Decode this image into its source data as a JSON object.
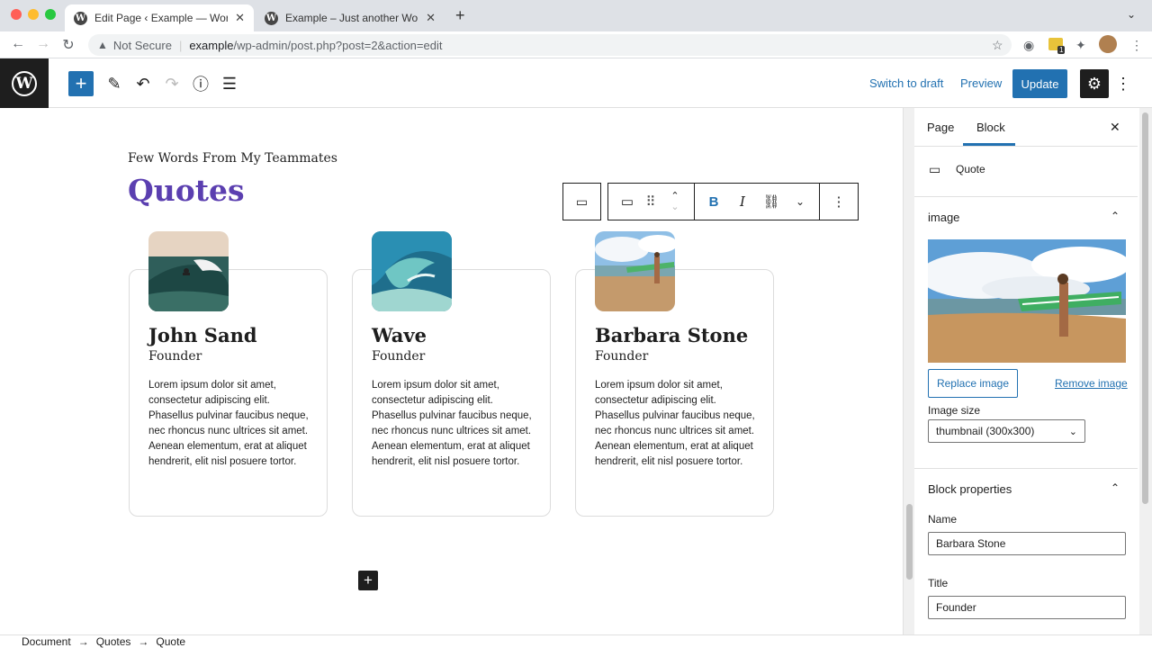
{
  "browser": {
    "tabs": [
      {
        "title": "Edit Page ‹ Example — WordPr",
        "active": true
      },
      {
        "title": "Example – Just another WordP",
        "active": false
      }
    ],
    "security_label": "Not Secure",
    "url_host": "example",
    "url_path": "/wp-admin/post.php?post=2&action=edit",
    "extension_badge": "1"
  },
  "topbar": {
    "switch_to_draft": "Switch to draft",
    "preview": "Preview",
    "update": "Update"
  },
  "content": {
    "subtitle": "Few Words From My Teammates",
    "heading": "Quotes",
    "heading_color": "#5b3fb0",
    "cards": [
      {
        "name": "John Sand",
        "title": "Founder",
        "body": "Lorem ipsum dolor sit amet, consectetur adipiscing elit. Phasellus pulvinar faucibus neque, nec rhoncus nunc ultrices sit amet. Aenean elementum, erat at aliquet hendrerit, elit nisl posuere tortor."
      },
      {
        "name": "Wave",
        "title": "Founder",
        "body": "Lorem ipsum dolor sit amet, consectetur adipiscing elit. Phasellus pulvinar faucibus neque, nec rhoncus nunc ultrices sit amet. Aenean elementum, erat at aliquet hendrerit, elit nisl posuere tortor."
      },
      {
        "name": "Barbara Stone",
        "title": "Founder",
        "body": "Lorem ipsum dolor sit amet, consectetur adipiscing elit. Phasellus pulvinar faucibus neque, nec rhoncus nunc ultrices sit amet. Aenean elementum, erat at aliquet hendrerit, elit nisl posuere tortor."
      }
    ]
  },
  "block_toolbar": {
    "bold": "B",
    "italic": "I"
  },
  "sidebar": {
    "tabs": [
      "Page",
      "Block"
    ],
    "active_tab": "Block",
    "block_name": "Quote",
    "image_section": "image",
    "replace_image": "Replace image",
    "remove_image": "Remove image",
    "image_size_label": "Image size",
    "image_size_value": "thumbnail (300x300)",
    "properties_section": "Block properties",
    "name_label": "Name",
    "name_value": "Barbara Stone",
    "title_label": "Title",
    "title_value": "Founder"
  },
  "breadcrumb": [
    "Document",
    "Quotes",
    "Quote"
  ],
  "colors": {
    "accent": "#2271b1",
    "dark": "#1e1e1e"
  }
}
